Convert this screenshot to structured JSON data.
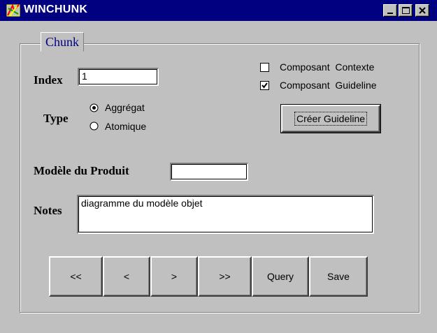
{
  "window": {
    "title": "WINCHUNK"
  },
  "group": {
    "label": "Chunk"
  },
  "index": {
    "label": "Index",
    "value": "1"
  },
  "type": {
    "label": "Type",
    "options": [
      {
        "label": "Aggrégat",
        "selected": true
      },
      {
        "label": "Atomique",
        "selected": false
      }
    ]
  },
  "checkboxes": [
    {
      "label": "Composant  Contexte",
      "checked": false
    },
    {
      "label": "Composant  Guideline",
      "checked": true
    }
  ],
  "create_guideline_button": "Créer Guideline",
  "product_model": {
    "label": "Modèle du Produit",
    "value": ""
  },
  "notes": {
    "label": "Notes",
    "value": "diagramme du modèle objet"
  },
  "nav_buttons": [
    "<<",
    "<",
    ">",
    ">>",
    "Query",
    "Save"
  ],
  "colors": {
    "titlebar": "#000080",
    "face": "#c0c0c0",
    "tab_text": "#000080"
  },
  "icons": {
    "app": "winchunk-app-icon",
    "minimize": "minimize-icon",
    "maximize": "maximize-icon",
    "close": "close-icon"
  }
}
